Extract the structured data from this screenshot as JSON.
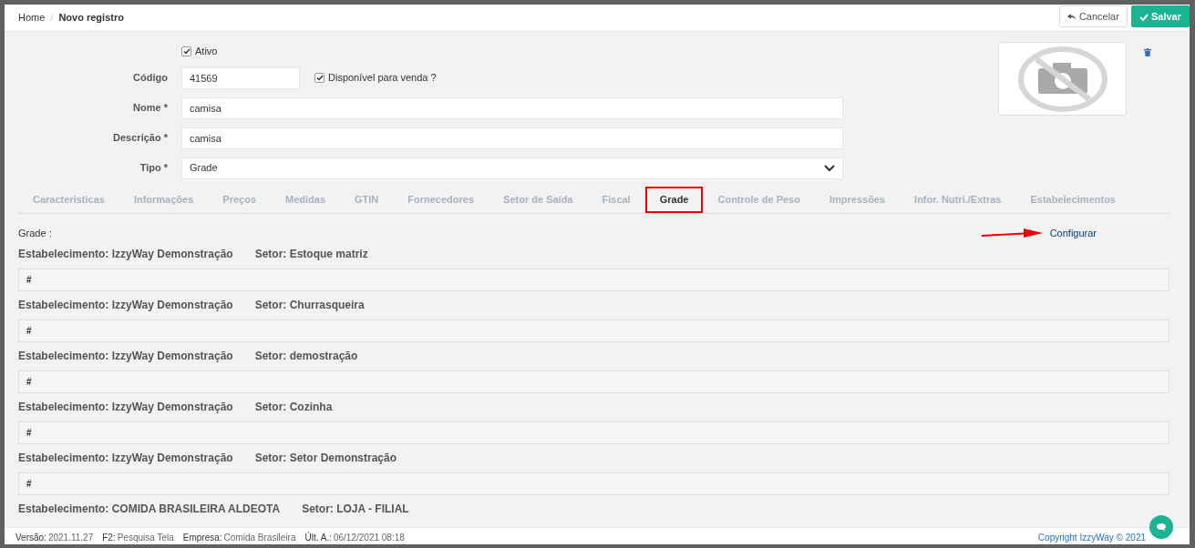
{
  "breadcrumb_separator": "/",
  "breadcrumb": [
    {
      "label": "Home",
      "active": false
    },
    {
      "label": "Novo registro",
      "active": true
    }
  ],
  "header_buttons": [
    {
      "kind": "cancel",
      "label": "Cancelar"
    },
    {
      "kind": "save",
      "label": "Salvar"
    }
  ],
  "form": {
    "ativo": {
      "label": "Ativo",
      "checked": true
    },
    "codigo": {
      "label": "Código",
      "value": "41569"
    },
    "disponivel": {
      "label": "Disponível para venda ?",
      "checked": true
    },
    "nome": {
      "label": "Nome *",
      "value": "camisa"
    },
    "descricao": {
      "label": "Descrição *",
      "value": "camisa"
    },
    "tipo": {
      "label": "Tipo *",
      "value": "Grade"
    }
  },
  "tabs": [
    {
      "label": "Caracteristicas",
      "selected": false
    },
    {
      "label": "Informações",
      "selected": false
    },
    {
      "label": "Preços",
      "selected": false
    },
    {
      "label": "Medidas",
      "selected": false
    },
    {
      "label": "GTIN",
      "selected": false
    },
    {
      "label": "Fornecedores",
      "selected": false
    },
    {
      "label": "Setor de Saída",
      "selected": false
    },
    {
      "label": "Fiscal",
      "selected": false
    },
    {
      "label": "Grade",
      "selected": true
    },
    {
      "label": "Controle de Peso",
      "selected": false
    },
    {
      "label": "Impressões",
      "selected": false
    },
    {
      "label": "Infor. Nutri./Extras",
      "selected": false
    },
    {
      "label": "Estabelecimentos",
      "selected": false
    }
  ],
  "grade": {
    "label": "Grade :",
    "configure_link": "Configurar",
    "groups": [
      {
        "estabelecimento": "Estabelecimento: IzzyWay Demonstração",
        "setor": "Setor: Estoque matriz",
        "header": "#"
      },
      {
        "estabelecimento": "Estabelecimento: IzzyWay Demonstração",
        "setor": "Setor: Churrasqueira",
        "header": "#"
      },
      {
        "estabelecimento": "Estabelecimento: IzzyWay Demonstração",
        "setor": "Setor: demostração",
        "header": "#"
      },
      {
        "estabelecimento": "Estabelecimento: IzzyWay Demonstração",
        "setor": "Setor: Cozinha",
        "header": "#"
      },
      {
        "estabelecimento": "Estabelecimento: IzzyWay Demonstração",
        "setor": "Setor: Setor Demonstração",
        "header": "#"
      },
      {
        "estabelecimento": "Estabelecimento: COMIDA BRASILEIRA ALDEOTA",
        "setor": "Setor: LOJA - FILIAL"
      }
    ]
  },
  "footer": {
    "items": [
      {
        "label": "Versão:",
        "value": "2021.11.27"
      },
      {
        "label": "F2:",
        "value": "Pesquisa Tela"
      },
      {
        "label": "Empresa:",
        "value": "Comida Brasileira"
      },
      {
        "label": "Últ. A.:",
        "value": "06/12/2021 08:18"
      }
    ],
    "copyright": "Copyright IzzyWay © 2021"
  }
}
